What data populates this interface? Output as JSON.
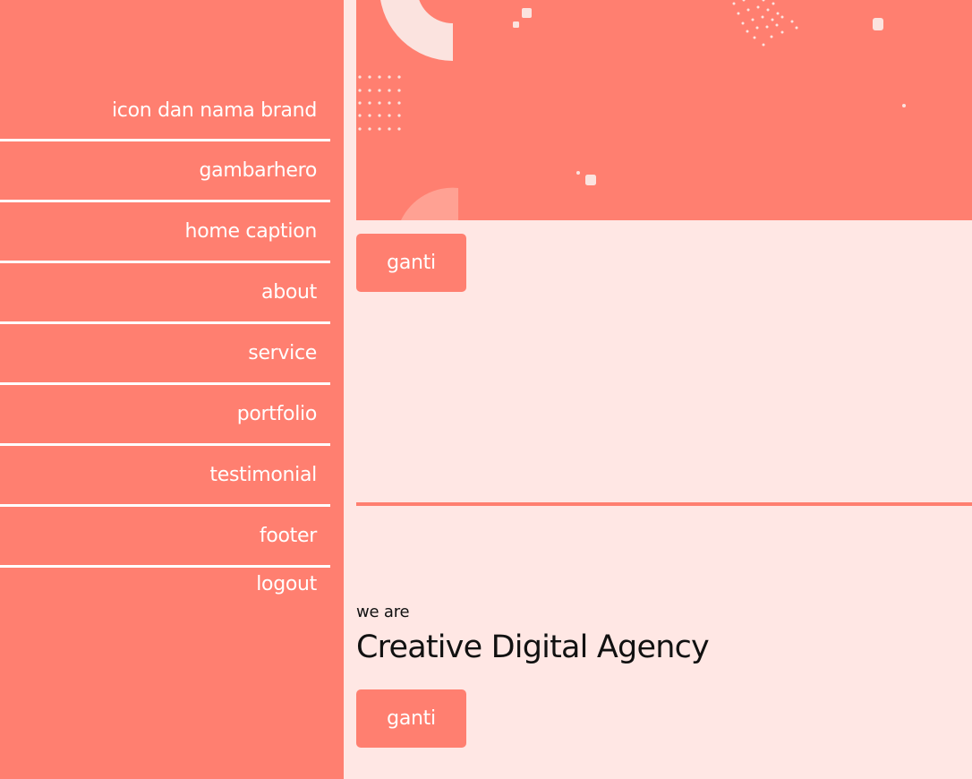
{
  "sidebar": {
    "items": [
      {
        "label": "icon dan nama brand"
      },
      {
        "label": "gambarhero"
      },
      {
        "label": "home caption"
      },
      {
        "label": "about"
      },
      {
        "label": "service"
      },
      {
        "label": "portfolio"
      },
      {
        "label": "testimonial"
      },
      {
        "label": "footer"
      }
    ],
    "logout_label": "logout"
  },
  "hero_section": {
    "replace_button_label": "ganti"
  },
  "caption_section": {
    "kicker": "we are",
    "headline": "Creative Digital Agency",
    "replace_button_label": "ganti"
  },
  "colors": {
    "accent": "#ff7f70",
    "page_background": "#ffe7e4",
    "text_dark": "#111111",
    "text_light": "#ffffff"
  }
}
